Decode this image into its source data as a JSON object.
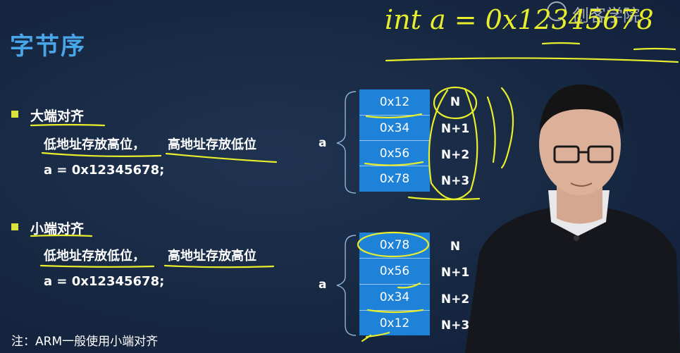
{
  "title": "字节序",
  "watermark": "创客学院",
  "handwriting": "int a = 0x12345678",
  "big_endian": {
    "heading": "大端对齐",
    "desc_1": "低地址存放高位，",
    "desc_2": "高地址存放低位",
    "code": "a = 0x12345678;",
    "var_label": "a",
    "cells": [
      "0x12",
      "0x34",
      "0x56",
      "0x78"
    ],
    "addresses": [
      "N",
      "N+1",
      "N+2",
      "N+3"
    ]
  },
  "little_endian": {
    "heading": "小端对齐",
    "desc_1": "低地址存放低位，",
    "desc_2": "高地址存放高位",
    "code": "a = 0x12345678;",
    "var_label": "a",
    "cells": [
      "0x78",
      "0x56",
      "0x34",
      "0x12"
    ],
    "addresses": [
      "N",
      "N+1",
      "N+2",
      "N+3"
    ]
  },
  "note": "注：ARM一般使用小端对齐",
  "colors": {
    "title": "#4aa6ea",
    "bullet": "#d9e33a",
    "cell": "#1e82d8",
    "ink": "#e8ee2c",
    "background": "#172842"
  }
}
